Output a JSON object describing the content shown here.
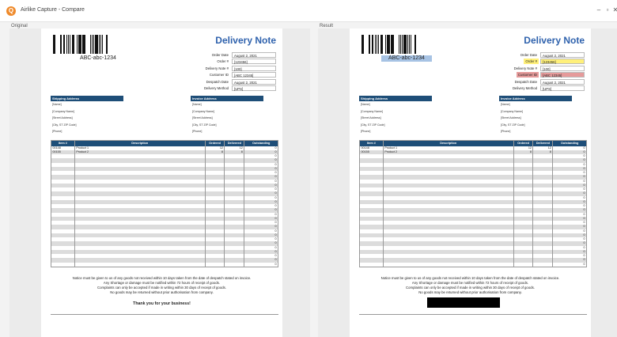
{
  "window": {
    "app_title": "Airlike Capture - Compare"
  },
  "panes": [
    {
      "label": "Original",
      "redacted_footer": false,
      "highlights": {
        "barcode": false,
        "order_no": false,
        "customer_id": false
      }
    },
    {
      "label": "Result",
      "redacted_footer": true,
      "highlights": {
        "barcode": true,
        "order_no": true,
        "customer_id": true
      }
    }
  ],
  "document": {
    "barcode_text": "ABC-abc-1234",
    "title": "Delivery Note",
    "info": [
      {
        "label": "Order Date",
        "value": "August 2, 2021"
      },
      {
        "label": "Order #",
        "value": "[123456]"
      },
      {
        "label": "Delivery Note #",
        "value": "[100]"
      },
      {
        "label": "Customer ID",
        "value": "[ABC 12345]"
      },
      {
        "label": "Despatch Date",
        "value": "August 2, 2021"
      },
      {
        "label": "Delivery Method",
        "value": "[UPS]"
      }
    ],
    "shipping": {
      "heading": "Shipping Address",
      "lines": [
        "[Name]",
        "[Company Name]",
        "[Street Address]",
        "[City, ST  ZIP Code]",
        "[Phone]"
      ]
    },
    "invoice": {
      "heading": "Invoice Address",
      "lines": [
        "[Name]",
        "[Company Name]",
        "[Street Address]",
        "[City, ST  ZIP Code]",
        "[Phone]"
      ]
    },
    "table": {
      "headers": [
        "Item #",
        "Description",
        "Ordered",
        "Delivered",
        "Outstanding"
      ],
      "rows": [
        [
          "00148",
          "Product 1",
          "12",
          "12",
          "0"
        ],
        [
          "00155",
          "Product 2",
          "8",
          "8",
          "0"
        ],
        [
          "",
          "",
          "",
          "",
          "0"
        ],
        [
          "",
          "",
          "",
          "",
          "0"
        ],
        [
          "",
          "",
          "",
          "",
          "0"
        ],
        [
          "",
          "",
          "",
          "",
          "0"
        ],
        [
          "",
          "",
          "",
          "",
          "0"
        ],
        [
          "",
          "",
          "",
          "",
          "0"
        ],
        [
          "",
          "",
          "",
          "",
          "0"
        ],
        [
          "",
          "",
          "",
          "",
          "0"
        ],
        [
          "",
          "",
          "",
          "",
          "0"
        ],
        [
          "",
          "",
          "",
          "",
          "0"
        ],
        [
          "",
          "",
          "",
          "",
          "0"
        ],
        [
          "",
          "",
          "",
          "",
          "0"
        ],
        [
          "",
          "",
          "",
          "",
          "0"
        ],
        [
          "",
          "",
          "",
          "",
          "0"
        ],
        [
          "",
          "",
          "",
          "",
          "0"
        ],
        [
          "",
          "",
          "",
          "",
          "0"
        ],
        [
          "",
          "",
          "",
          "",
          "0"
        ],
        [
          "",
          "",
          "",
          "",
          "0"
        ],
        [
          "",
          "",
          "",
          "",
          "0"
        ],
        [
          "",
          "",
          "",
          "",
          "0"
        ],
        [
          "",
          "",
          "",
          "",
          "0"
        ],
        [
          "",
          "",
          "",
          "",
          "0"
        ],
        [
          "",
          "",
          "",
          "",
          "0"
        ],
        [
          "",
          "",
          "",
          "",
          "0"
        ],
        [
          "",
          "",
          "",
          "",
          "0"
        ],
        [
          "",
          "",
          "",
          "",
          "0"
        ],
        [
          "",
          "",
          "",
          "",
          "0"
        ]
      ]
    },
    "notice": [
      "Notice must be given to us of any goods not received within 10 days taken from the date of despatch stated on invoice.",
      "Any Shortage or damage must be notified within 72 hours of receipt of goods.",
      "Complaints can only be accepted if made in writing within 30 days of receipt of goods.",
      "No goods may be returned without prior authorisation from company."
    ],
    "thanks": "Thank you for your business!"
  },
  "colors": {
    "title": "#2f62ad",
    "header_bar": "#1e4e78",
    "highlight_yellow": "#fff07a",
    "highlight_red": "#e59a9a",
    "highlight_blue": "#a7c3e4"
  }
}
